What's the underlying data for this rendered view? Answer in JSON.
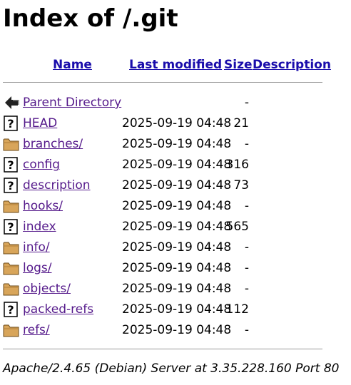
{
  "title": "Index of /.git",
  "columns": {
    "name": "Name",
    "modified": "Last modified",
    "size": "Size",
    "description": "Description"
  },
  "rows": [
    {
      "icon": "back-icon",
      "name": "Parent Directory",
      "modified": "",
      "size": "-"
    },
    {
      "icon": "unknown-file-icon",
      "name": "HEAD",
      "modified": "2025-09-19 04:48",
      "size": "21"
    },
    {
      "icon": "folder-icon",
      "name": "branches/",
      "modified": "2025-09-19 04:48",
      "size": "-"
    },
    {
      "icon": "unknown-file-icon",
      "name": "config",
      "modified": "2025-09-19 04:48",
      "size": "316"
    },
    {
      "icon": "unknown-file-icon",
      "name": "description",
      "modified": "2025-09-19 04:48",
      "size": "73"
    },
    {
      "icon": "folder-icon",
      "name": "hooks/",
      "modified": "2025-09-19 04:48",
      "size": "-"
    },
    {
      "icon": "unknown-file-icon",
      "name": "index",
      "modified": "2025-09-19 04:48",
      "size": "565"
    },
    {
      "icon": "folder-icon",
      "name": "info/",
      "modified": "2025-09-19 04:48",
      "size": "-"
    },
    {
      "icon": "folder-icon",
      "name": "logs/",
      "modified": "2025-09-19 04:48",
      "size": "-"
    },
    {
      "icon": "folder-icon",
      "name": "objects/",
      "modified": "2025-09-19 04:48",
      "size": "-"
    },
    {
      "icon": "unknown-file-icon",
      "name": "packed-refs",
      "modified": "2025-09-19 04:48",
      "size": "112"
    },
    {
      "icon": "folder-icon",
      "name": "refs/",
      "modified": "2025-09-19 04:48",
      "size": "-"
    }
  ],
  "footer": "Apache/2.4.65 (Debian) Server at 3.35.228.160 Port 80"
}
